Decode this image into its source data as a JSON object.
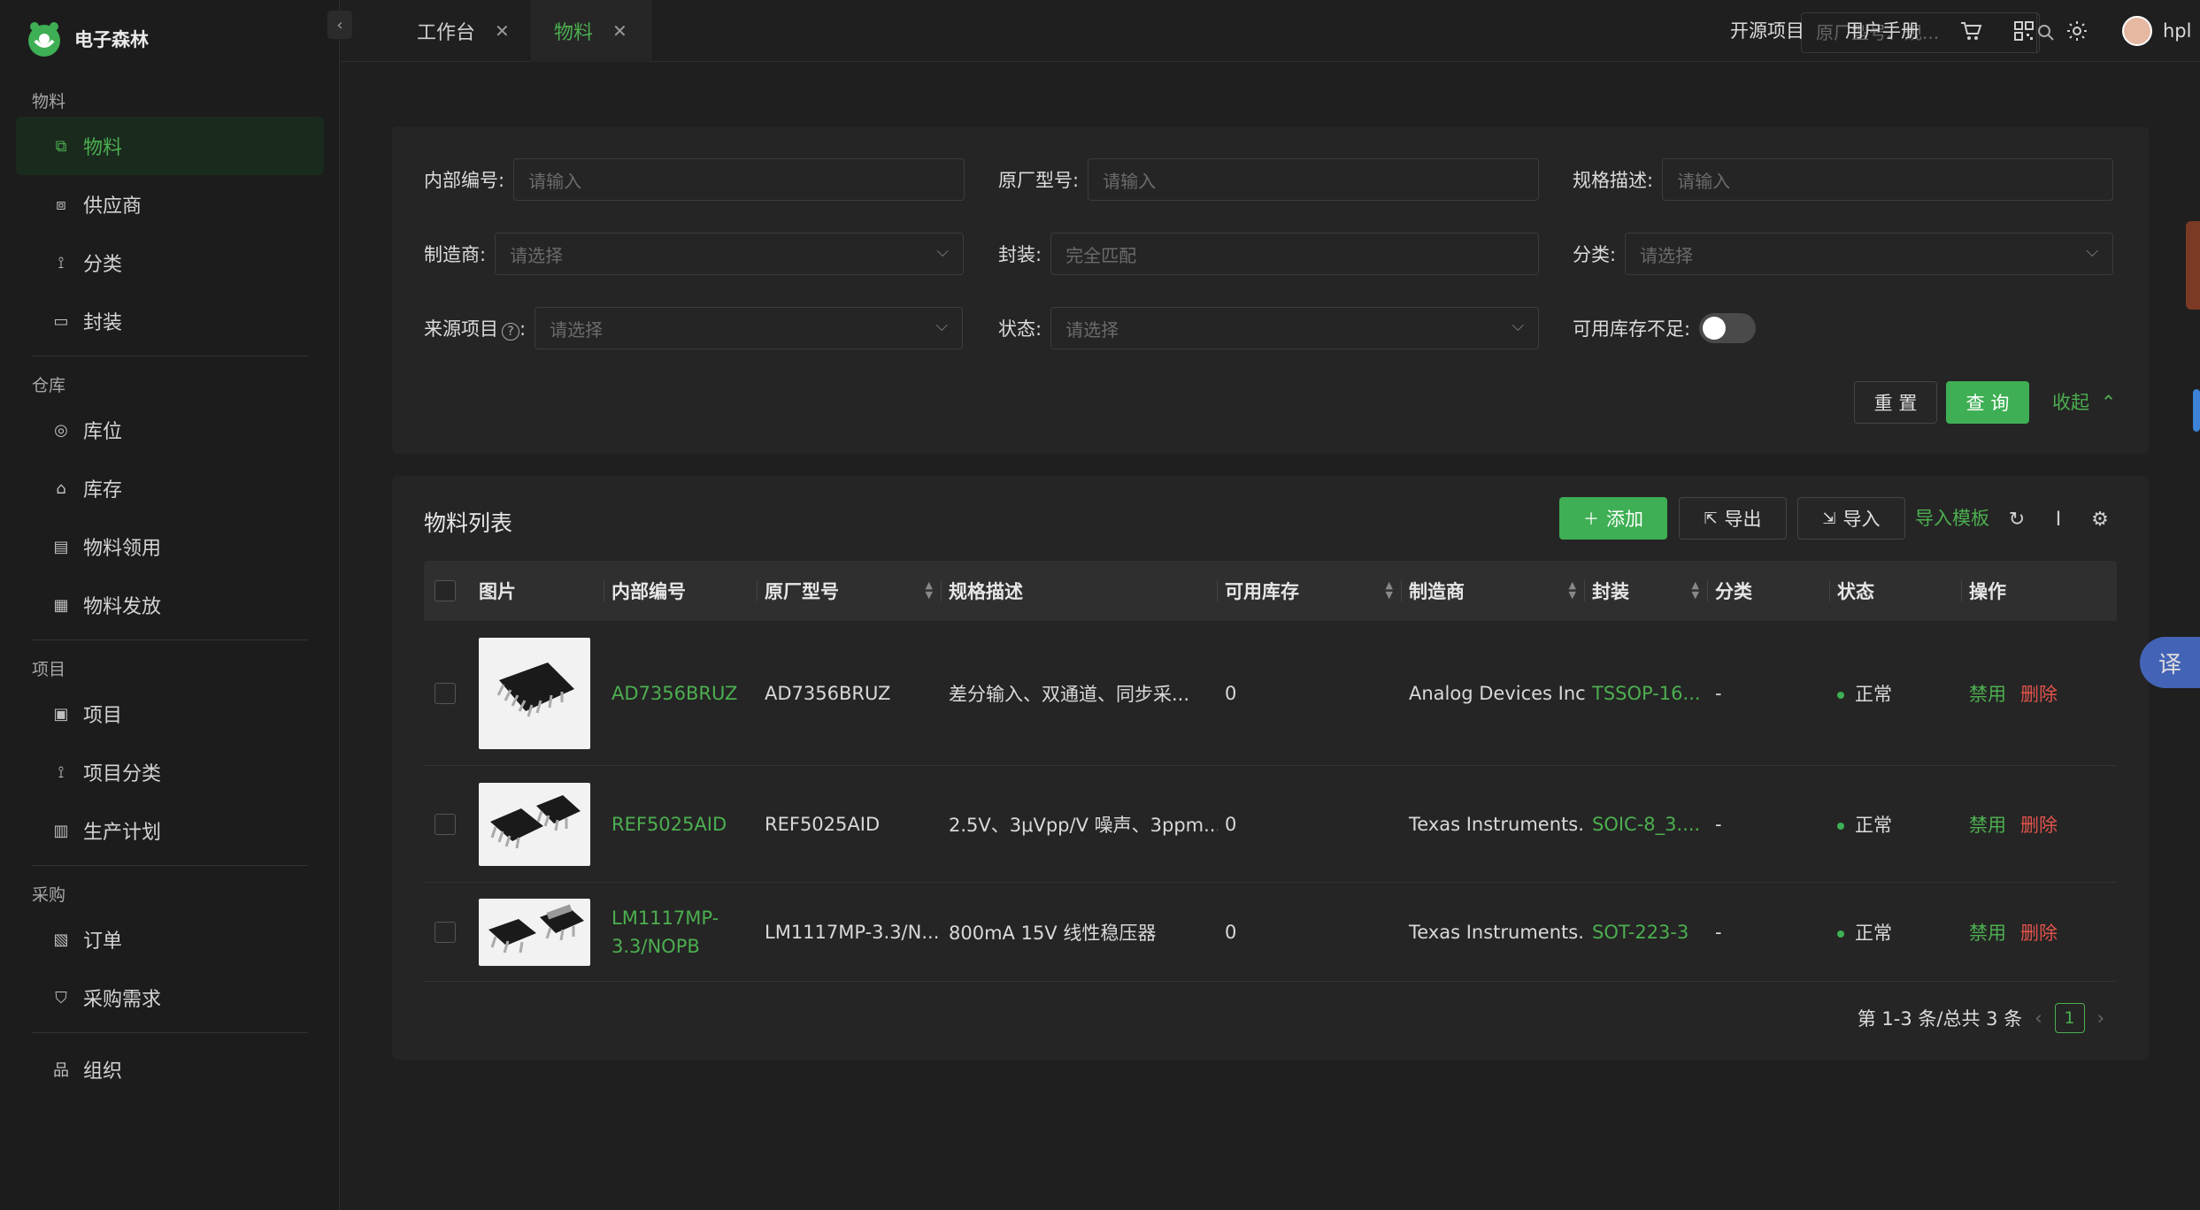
{
  "app": {
    "title": "电子森林"
  },
  "sidebar": {
    "groups": [
      {
        "title": "物料",
        "items": [
          {
            "label": "物料",
            "icon": "material-icon",
            "active": true
          },
          {
            "label": "供应商",
            "icon": "supplier-icon"
          },
          {
            "label": "分类",
            "icon": "category-icon"
          },
          {
            "label": "封装",
            "icon": "package-icon"
          }
        ]
      },
      {
        "title": "仓库",
        "items": [
          {
            "label": "库位",
            "icon": "location-icon"
          },
          {
            "label": "库存",
            "icon": "inventory-icon"
          },
          {
            "label": "物料领用",
            "icon": "material-request-icon"
          },
          {
            "label": "物料发放",
            "icon": "material-issue-icon"
          }
        ]
      },
      {
        "title": "项目",
        "items": [
          {
            "label": "项目",
            "icon": "project-icon"
          },
          {
            "label": "项目分类",
            "icon": "project-category-icon"
          },
          {
            "label": "生产计划",
            "icon": "production-plan-icon"
          }
        ]
      },
      {
        "title": "采购",
        "items": [
          {
            "label": "订单",
            "icon": "order-icon"
          },
          {
            "label": "采购需求",
            "icon": "purchase-request-icon"
          }
        ]
      },
      {
        "title": "",
        "items": [
          {
            "label": "组织",
            "icon": "organization-icon"
          }
        ]
      }
    ]
  },
  "tabs": [
    {
      "label": "工作台",
      "active": false
    },
    {
      "label": "物料",
      "active": true
    }
  ],
  "header": {
    "search_placeholder": "原厂型号、规...",
    "links": [
      "开源项目",
      "用户手册"
    ],
    "user": "hpl"
  },
  "filters": {
    "internal_code": {
      "label": "内部编号:",
      "placeholder": "请输入"
    },
    "mpn": {
      "label": "原厂型号:",
      "placeholder": "请输入"
    },
    "spec": {
      "label": "规格描述:",
      "placeholder": "请输入"
    },
    "manufacturer": {
      "label": "制造商:",
      "placeholder": "请选择"
    },
    "package": {
      "label": "封装:",
      "placeholder": "完全匹配"
    },
    "category": {
      "label": "分类:",
      "placeholder": "请选择"
    },
    "source_project": {
      "label": "来源项目",
      "suffix": ":",
      "placeholder": "请选择"
    },
    "status": {
      "label": "状态:",
      "placeholder": "请选择"
    },
    "low_stock": {
      "label": "可用库存不足:",
      "enabled": false
    },
    "reset_label": "重 置",
    "query_label": "查 询",
    "collapse_label": "收起"
  },
  "list": {
    "title": "物料列表",
    "toolbar": {
      "add": "添加",
      "export": "导出",
      "import": "导入",
      "template": "导入模板"
    },
    "columns": [
      "图片",
      "内部编号",
      "原厂型号",
      "规格描述",
      "可用库存",
      "制造商",
      "封装",
      "分类",
      "状态",
      "操作"
    ],
    "rows": [
      {
        "code": "AD7356BRUZ",
        "mpn": "AD7356BRUZ",
        "spec": "差分输入、双通道、同步采...",
        "stock": "0",
        "manufacturer": "Analog Devices Inc.",
        "package": "TSSOP-16...",
        "category": "-",
        "status": "正常",
        "action_disable": "禁用",
        "action_delete": "删除"
      },
      {
        "code": "REF5025AID",
        "mpn": "REF5025AID",
        "spec": "2.5V、3μVpp/V 噪声、3ppm...",
        "stock": "0",
        "manufacturer": "Texas Instruments...",
        "package": "SOIC-8_3....",
        "category": "-",
        "status": "正常",
        "action_disable": "禁用",
        "action_delete": "删除"
      },
      {
        "code": "LM1117MP-3.3/NOPB",
        "code_line1": "LM1117MP-",
        "code_line2": "3.3/NOPB",
        "mpn": "LM1117MP-3.3/N...",
        "spec": "800mA 15V 线性稳压器",
        "stock": "0",
        "manufacturer": "Texas Instruments...",
        "package": "SOT-223-3",
        "category": "-",
        "status": "正常",
        "action_disable": "禁用",
        "action_delete": "删除"
      }
    ],
    "pagination": {
      "summary": "第 1-3 条/总共 3 条",
      "current": "1"
    }
  },
  "floating": {
    "translate": "译"
  },
  "colors": {
    "accent": "#4caf50",
    "danger": "#e0534c",
    "background": "#1f1f1f",
    "panel": "#252525"
  }
}
